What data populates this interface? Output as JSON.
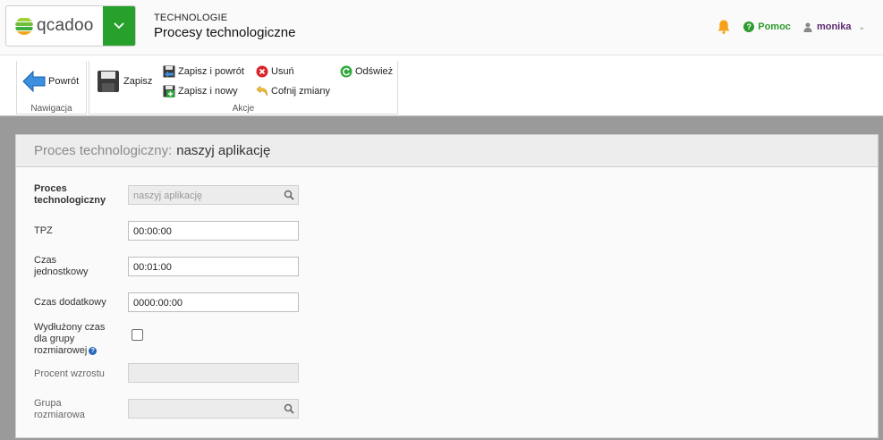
{
  "header": {
    "logo_text": "qcadoo",
    "category": "TECHNOLOGIE",
    "title": "Procesy technologiczne",
    "help_label": "Pomoc",
    "user_name": "monika",
    "accent_color": "#27a12c"
  },
  "ribbon": {
    "groups": [
      {
        "label": "Nawigacja",
        "items": [
          {
            "label": "Powrót",
            "icon": "back-arrow-icon"
          }
        ]
      },
      {
        "label": "Akcje",
        "items": [
          {
            "label": "Zapisz",
            "icon": "save-icon"
          },
          {
            "label": "Zapisz i powrót",
            "icon": "save-back-icon"
          },
          {
            "label": "Zapisz i nowy",
            "icon": "save-new-icon"
          },
          {
            "label": "Usuń",
            "icon": "delete-icon"
          },
          {
            "label": "Cofnij zmiany",
            "icon": "undo-icon"
          },
          {
            "label": "Odśwież",
            "icon": "refresh-icon"
          }
        ]
      }
    ]
  },
  "form": {
    "header_label": "Proces technologiczny:",
    "header_value": "naszyj aplikację",
    "fields": [
      {
        "label": "Proces technologiczny",
        "value": "naszyj aplikację",
        "type": "lookup",
        "disabled": true
      },
      {
        "label": "TPZ",
        "value": "00:00:00",
        "type": "text"
      },
      {
        "label": "Czas jednostkowy",
        "value": "00:01:00",
        "type": "text"
      },
      {
        "label": "Czas dodatkowy",
        "value": "0000:00:00",
        "type": "text"
      },
      {
        "label": "Wydłużony czas dla grupy rozmiarowej",
        "value": false,
        "type": "checkbox"
      },
      {
        "label": "Procent wzrostu",
        "value": "",
        "type": "text",
        "disabled": true
      },
      {
        "label": "Grupa rozmiarowa",
        "value": "",
        "type": "lookup",
        "disabled": true
      }
    ]
  }
}
